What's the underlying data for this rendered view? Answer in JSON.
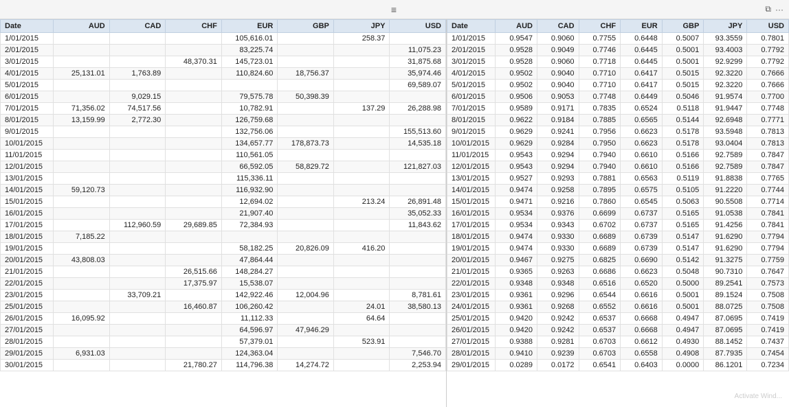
{
  "titleBar": {
    "hamburgerIcon": "≡",
    "restoreIcon": "⧉",
    "moreIcon": "···"
  },
  "leftTable": {
    "headers": [
      "Date",
      "AUD",
      "CAD",
      "CHF",
      "EUR",
      "GBP",
      "JPY",
      "USD"
    ],
    "rows": [
      [
        "1/01/2015",
        "",
        "",
        "",
        "105,616.01",
        "",
        "258.37",
        ""
      ],
      [
        "2/01/2015",
        "",
        "",
        "",
        "83,225.74",
        "",
        "",
        "11,075.23"
      ],
      [
        "3/01/2015",
        "",
        "",
        "48,370.31",
        "145,723.01",
        "",
        "",
        "31,875.68"
      ],
      [
        "4/01/2015",
        "25,131.01",
        "1,763.89",
        "",
        "110,824.60",
        "18,756.37",
        "",
        "35,974.46"
      ],
      [
        "5/01/2015",
        "",
        "",
        "",
        "",
        "",
        "",
        "69,589.07"
      ],
      [
        "6/01/2015",
        "",
        "9,029.15",
        "",
        "79,575.78",
        "50,398.39",
        "",
        ""
      ],
      [
        "7/01/2015",
        "71,356.02",
        "74,517.56",
        "",
        "10,782.91",
        "",
        "137.29",
        "26,288.98"
      ],
      [
        "8/01/2015",
        "13,159.99",
        "2,772.30",
        "",
        "126,759.68",
        "",
        "",
        ""
      ],
      [
        "9/01/2015",
        "",
        "",
        "",
        "132,756.06",
        "",
        "",
        "155,513.60"
      ],
      [
        "10/01/2015",
        "",
        "",
        "",
        "134,657.77",
        "178,873.73",
        "",
        "14,535.18"
      ],
      [
        "11/01/2015",
        "",
        "",
        "",
        "110,561.05",
        "",
        "",
        ""
      ],
      [
        "12/01/2015",
        "",
        "",
        "",
        "66,592.05",
        "58,829.72",
        "",
        "121,827.03"
      ],
      [
        "13/01/2015",
        "",
        "",
        "",
        "115,336.11",
        "",
        "",
        ""
      ],
      [
        "14/01/2015",
        "59,120.73",
        "",
        "",
        "116,932.90",
        "",
        "",
        ""
      ],
      [
        "15/01/2015",
        "",
        "",
        "",
        "12,694.02",
        "",
        "213.24",
        "26,891.48"
      ],
      [
        "16/01/2015",
        "",
        "",
        "",
        "21,907.40",
        "",
        "",
        "35,052.33"
      ],
      [
        "17/01/2015",
        "",
        "112,960.59",
        "29,689.85",
        "72,384.93",
        "",
        "",
        "11,843.62"
      ],
      [
        "18/01/2015",
        "7,185.22",
        "",
        "",
        "",
        "",
        "",
        ""
      ],
      [
        "19/01/2015",
        "",
        "",
        "",
        "58,182.25",
        "20,826.09",
        "416.20",
        ""
      ],
      [
        "20/01/2015",
        "43,808.03",
        "",
        "",
        "47,864.44",
        "",
        "",
        ""
      ],
      [
        "21/01/2015",
        "",
        "",
        "26,515.66",
        "148,284.27",
        "",
        "",
        ""
      ],
      [
        "22/01/2015",
        "",
        "",
        "17,375.97",
        "15,538.07",
        "",
        "",
        ""
      ],
      [
        "23/01/2015",
        "",
        "33,709.21",
        "",
        "142,922.46",
        "12,004.96",
        "",
        "8,781.61"
      ],
      [
        "25/01/2015",
        "",
        "",
        "16,460.87",
        "106,260.42",
        "",
        "24.01",
        "38,580.13"
      ],
      [
        "26/01/2015",
        "16,095.92",
        "",
        "",
        "11,112.33",
        "",
        "64.64",
        ""
      ],
      [
        "27/01/2015",
        "",
        "",
        "",
        "64,596.97",
        "47,946.29",
        "",
        ""
      ],
      [
        "28/01/2015",
        "",
        "",
        "",
        "57,379.01",
        "",
        "523.91",
        ""
      ],
      [
        "29/01/2015",
        "6,931.03",
        "",
        "",
        "124,363.04",
        "",
        "",
        "7,546.70"
      ],
      [
        "30/01/2015",
        "",
        "",
        "21,780.27",
        "114,796.38",
        "14,274.72",
        "",
        "2,253.94"
      ]
    ]
  },
  "rightTable": {
    "headers": [
      "Date",
      "AUD",
      "CAD",
      "CHF",
      "EUR",
      "GBP",
      "JPY",
      "USD"
    ],
    "rows": [
      [
        "1/01/2015",
        "0.9547",
        "0.9060",
        "0.7755",
        "0.6448",
        "0.5007",
        "93.3559",
        "0.7801"
      ],
      [
        "2/01/2015",
        "0.9528",
        "0.9049",
        "0.7746",
        "0.6445",
        "0.5001",
        "93.4003",
        "0.7792"
      ],
      [
        "3/01/2015",
        "0.9528",
        "0.9060",
        "0.7718",
        "0.6445",
        "0.5001",
        "92.9299",
        "0.7792"
      ],
      [
        "4/01/2015",
        "0.9502",
        "0.9040",
        "0.7710",
        "0.6417",
        "0.5015",
        "92.3220",
        "0.7666"
      ],
      [
        "5/01/2015",
        "0.9502",
        "0.9040",
        "0.7710",
        "0.6417",
        "0.5015",
        "92.3220",
        "0.7666"
      ],
      [
        "6/01/2015",
        "0.9506",
        "0.9053",
        "0.7748",
        "0.6449",
        "0.5046",
        "91.9574",
        "0.7700"
      ],
      [
        "7/01/2015",
        "0.9589",
        "0.9171",
        "0.7835",
        "0.6524",
        "0.5118",
        "91.9447",
        "0.7748"
      ],
      [
        "8/01/2015",
        "0.9622",
        "0.9184",
        "0.7885",
        "0.6565",
        "0.5144",
        "92.6948",
        "0.7771"
      ],
      [
        "9/01/2015",
        "0.9629",
        "0.9241",
        "0.7956",
        "0.6623",
        "0.5178",
        "93.5948",
        "0.7813"
      ],
      [
        "10/01/2015",
        "0.9629",
        "0.9284",
        "0.7950",
        "0.6623",
        "0.5178",
        "93.0404",
        "0.7813"
      ],
      [
        "11/01/2015",
        "0.9543",
        "0.9294",
        "0.7940",
        "0.6610",
        "0.5166",
        "92.7589",
        "0.7847"
      ],
      [
        "12/01/2015",
        "0.9543",
        "0.9294",
        "0.7940",
        "0.6610",
        "0.5166",
        "92.7589",
        "0.7847"
      ],
      [
        "13/01/2015",
        "0.9527",
        "0.9293",
        "0.7881",
        "0.6563",
        "0.5119",
        "91.8838",
        "0.7765"
      ],
      [
        "14/01/2015",
        "0.9474",
        "0.9258",
        "0.7895",
        "0.6575",
        "0.5105",
        "91.2220",
        "0.7744"
      ],
      [
        "15/01/2015",
        "0.9471",
        "0.9216",
        "0.7860",
        "0.6545",
        "0.5063",
        "90.5508",
        "0.7714"
      ],
      [
        "16/01/2015",
        "0.9534",
        "0.9376",
        "0.6699",
        "0.6737",
        "0.5165",
        "91.0538",
        "0.7841"
      ],
      [
        "17/01/2015",
        "0.9534",
        "0.9343",
        "0.6702",
        "0.6737",
        "0.5165",
        "91.4256",
        "0.7841"
      ],
      [
        "18/01/2015",
        "0.9474",
        "0.9330",
        "0.6689",
        "0.6739",
        "0.5147",
        "91.6290",
        "0.7794"
      ],
      [
        "19/01/2015",
        "0.9474",
        "0.9330",
        "0.6689",
        "0.6739",
        "0.5147",
        "91.6290",
        "0.7794"
      ],
      [
        "20/01/2015",
        "0.9467",
        "0.9275",
        "0.6825",
        "0.6690",
        "0.5142",
        "91.3275",
        "0.7759"
      ],
      [
        "21/01/2015",
        "0.9365",
        "0.9263",
        "0.6686",
        "0.6623",
        "0.5048",
        "90.7310",
        "0.7647"
      ],
      [
        "22/01/2015",
        "0.9348",
        "0.9348",
        "0.6516",
        "0.6520",
        "0.5000",
        "89.2541",
        "0.7573"
      ],
      [
        "23/01/2015",
        "0.9361",
        "0.9296",
        "0.6544",
        "0.6616",
        "0.5001",
        "89.1524",
        "0.7508"
      ],
      [
        "24/01/2015",
        "0.9361",
        "0.9268",
        "0.6552",
        "0.6616",
        "0.5001",
        "88.0725",
        "0.7508"
      ],
      [
        "25/01/2015",
        "0.9420",
        "0.9242",
        "0.6537",
        "0.6668",
        "0.4947",
        "87.0695",
        "0.7419"
      ],
      [
        "26/01/2015",
        "0.9420",
        "0.9242",
        "0.6537",
        "0.6668",
        "0.4947",
        "87.0695",
        "0.7419"
      ],
      [
        "27/01/2015",
        "0.9388",
        "0.9281",
        "0.6703",
        "0.6612",
        "0.4930",
        "88.1452",
        "0.7437"
      ],
      [
        "28/01/2015",
        "0.9410",
        "0.9239",
        "0.6703",
        "0.6558",
        "0.4908",
        "87.7935",
        "0.7454"
      ],
      [
        "29/01/2015",
        "0.0289",
        "0.0172",
        "0.6541",
        "0.6403",
        "0.0000",
        "86.1201",
        "0.7234"
      ]
    ]
  },
  "watermark": "Activate Wind..."
}
